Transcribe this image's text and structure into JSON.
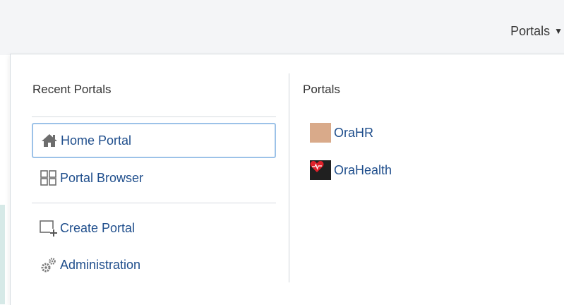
{
  "header": {
    "portals_menu_label": "Portals"
  },
  "recent_portals": {
    "title": "Recent Portals",
    "items": [
      {
        "label": "Home Portal",
        "icon": "home-icon",
        "focused": true
      },
      {
        "label": "Portal Browser",
        "icon": "grid-icon"
      }
    ],
    "actions": [
      {
        "label": "Create Portal",
        "icon": "create-portal-icon"
      },
      {
        "label": "Administration",
        "icon": "gears-icon"
      }
    ]
  },
  "portals": {
    "title": "Portals",
    "items": [
      {
        "label": "OraHR",
        "icon": "orahr-thumbnail",
        "color": "#d9aa8a"
      },
      {
        "label": "OraHealth",
        "icon": "orahealth-heart-thumbnail",
        "color": "#e0202a"
      }
    ]
  },
  "colors": {
    "link": "#1f4e8c",
    "focus_border": "#9cc2e8",
    "topbar_bg": "#f4f5f7"
  }
}
